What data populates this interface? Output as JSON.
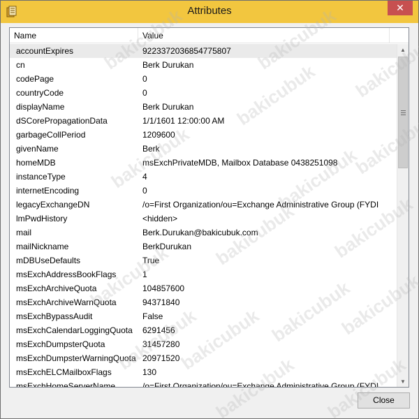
{
  "window": {
    "title": "Attributes",
    "close_glyph": "✕"
  },
  "listview": {
    "columns": [
      "Name",
      "Value"
    ],
    "rows": [
      {
        "name": "accountExpires",
        "value": "9223372036854775807"
      },
      {
        "name": "cn",
        "value": "Berk Durukan"
      },
      {
        "name": "codePage",
        "value": "0"
      },
      {
        "name": "countryCode",
        "value": "0"
      },
      {
        "name": "displayName",
        "value": "Berk Durukan"
      },
      {
        "name": "dSCorePropagationData",
        "value": "1/1/1601 12:00:00 AM"
      },
      {
        "name": "garbageCollPeriod",
        "value": "1209600"
      },
      {
        "name": "givenName",
        "value": "Berk"
      },
      {
        "name": "homeMDB",
        "value": "msExchPrivateMDB, Mailbox Database 0438251098"
      },
      {
        "name": "instanceType",
        "value": "4"
      },
      {
        "name": "internetEncoding",
        "value": "0"
      },
      {
        "name": "legacyExchangeDN",
        "value": "/o=First Organization/ou=Exchange Administrative Group (FYDI"
      },
      {
        "name": "lmPwdHistory",
        "value": "<hidden>"
      },
      {
        "name": "mail",
        "value": "Berk.Durukan@bakicubuk.com"
      },
      {
        "name": "mailNickname",
        "value": "BerkDurukan"
      },
      {
        "name": "mDBUseDefaults",
        "value": "True"
      },
      {
        "name": "msExchAddressBookFlags",
        "value": "1"
      },
      {
        "name": "msExchArchiveQuota",
        "value": "104857600"
      },
      {
        "name": "msExchArchiveWarnQuota",
        "value": "94371840"
      },
      {
        "name": "msExchBypassAudit",
        "value": "False"
      },
      {
        "name": "msExchCalendarLoggingQuota",
        "value": "6291456"
      },
      {
        "name": "msExchDumpsterQuota",
        "value": "31457280"
      },
      {
        "name": "msExchDumpsterWarningQuota",
        "value": "20971520"
      },
      {
        "name": "msExchELCMailboxFlags",
        "value": "130"
      },
      {
        "name": "msExchHomeServerName",
        "value": "/o=First Organization/ou=Exchange Administrative Group (FYDI"
      }
    ],
    "selected_index": 0
  },
  "buttons": {
    "close_label": "Close"
  },
  "watermark": {
    "text": "bakicubuk"
  },
  "colors": {
    "titlebar": "#f2c63f",
    "close_red": "#c75050",
    "selected_row": "#eaeaea"
  },
  "icons": {
    "app": "attribute-editor-icon",
    "scroll_up": "chevron-up-icon",
    "scroll_down": "chevron-down-icon"
  }
}
